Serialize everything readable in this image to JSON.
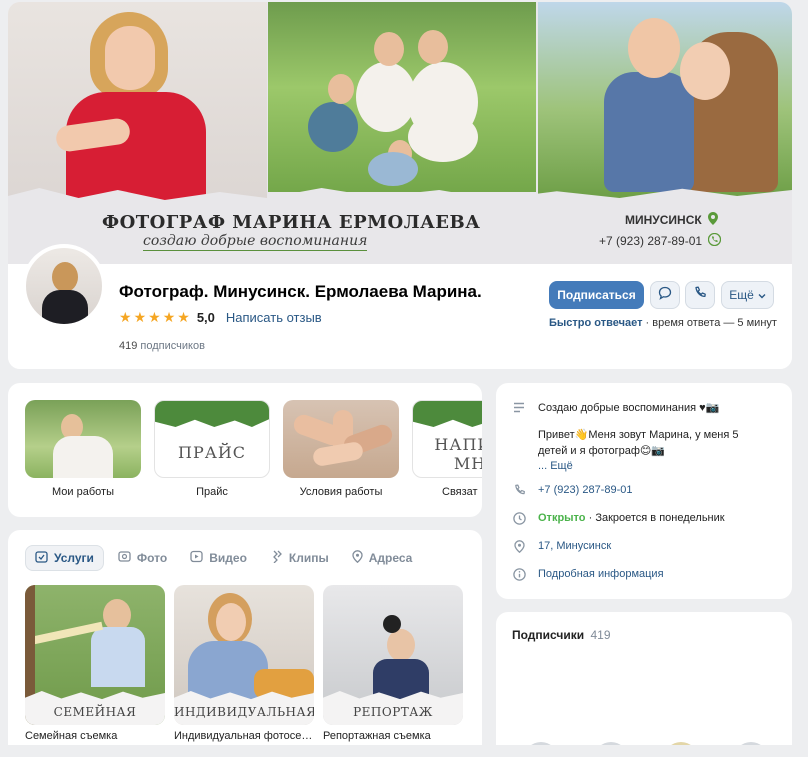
{
  "cover": {
    "title": "ФОТОГРАФ МАРИНА ЕРМОЛАЕВА",
    "subtitle": "создаю добрые воспоминания",
    "city": "МИНУСИНСК",
    "phone": "+7 (923) 287-89-01"
  },
  "header": {
    "group_name": "Фотограф. Минусинск. Ермолаева Марина.",
    "rating_value": "5,0",
    "review_link": "Написать отзыв",
    "subscribers_count": "419",
    "subscribers_label": "подписчиков",
    "subscribe_button": "Подписаться",
    "more_button": "Ещё",
    "fast_reply_label": "Быстро отвечает",
    "fast_reply_time": "· время ответа — 5 минут"
  },
  "links": [
    {
      "label": "Мои работы"
    },
    {
      "label": "Прайс",
      "image_text": "ПРАЙС"
    },
    {
      "label": "Условия работы"
    },
    {
      "label": "Связат",
      "image_text": "НАПИС\nМН"
    }
  ],
  "tabs": [
    {
      "label": "Услуги",
      "icon": "services-icon",
      "active": true
    },
    {
      "label": "Фото",
      "icon": "photo-icon"
    },
    {
      "label": "Видео",
      "icon": "video-icon"
    },
    {
      "label": "Клипы",
      "icon": "clips-icon"
    },
    {
      "label": "Адреса",
      "icon": "location-icon"
    }
  ],
  "services": [
    {
      "image_text": "СЕМЕЙНАЯ",
      "name": "Семейная съемка"
    },
    {
      "image_text": "ИНДИВИДУАЛЬНАЯ",
      "name": "Индивидуальная фотосе…"
    },
    {
      "image_text": "РЕПОРТАЖ",
      "name": "Репортажная съемка"
    }
  ],
  "info": {
    "description_line1": "Создаю добрые воспоминания ♥📷",
    "description_line2": "Привет👋Меня зовут Марина, у меня 5 детей и я фотограф😊📷",
    "description_more": "... Ещё",
    "phone": "+7 (923) 287-89-01",
    "open_status": "Открыто",
    "closes": "· Закроется в понедельник",
    "address": "17, Минусинск",
    "details_link": "Подробная информация"
  },
  "subscribers_block": {
    "title": "Подписчики",
    "count": "419"
  },
  "colors": {
    "accent": "#447bba",
    "link": "#2a5885",
    "open_green": "#4bb34b",
    "background": "#edeef0",
    "star": "#f5a623"
  }
}
